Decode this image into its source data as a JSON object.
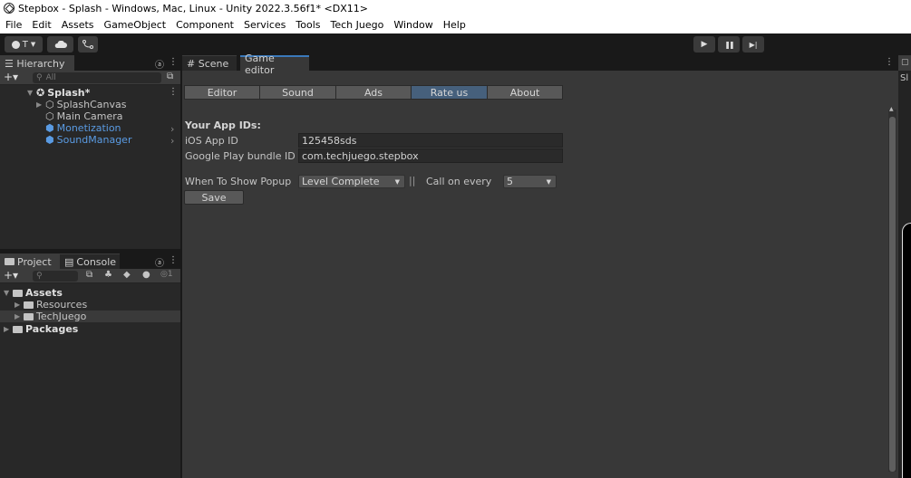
{
  "window": {
    "title": "Stepbox - Splash - Windows, Mac, Linux - Unity 2022.3.56f1* <DX11>"
  },
  "menu": [
    "File",
    "Edit",
    "Assets",
    "GameObject",
    "Component",
    "Services",
    "Tools",
    "Tech Juego",
    "Window",
    "Help"
  ],
  "toolbar": {
    "account_label": "T",
    "play_icon": "▶",
    "pause_icon": "❚❚",
    "step_icon": "▶|"
  },
  "hierarchy": {
    "tab_label": "☰ Hierarchy",
    "search_placeholder": "All",
    "scene": "Splash*",
    "items": [
      "SplashCanvas",
      "Main Camera",
      "Monetization",
      "SoundManager"
    ]
  },
  "project": {
    "tabs": [
      "Project",
      "Console"
    ],
    "search_placeholder": "",
    "count_hint": "1",
    "items": [
      "Assets",
      "Resources",
      "TechJuego",
      "Packages"
    ]
  },
  "editor": {
    "tabs": [
      "# Scene",
      "Game editor"
    ],
    "segments": [
      "Editor",
      "Sound",
      "Ads",
      "Rate us",
      "About"
    ],
    "active_segment": "Rate us",
    "section_title": "Your App IDs:",
    "ios_label": "iOS App ID",
    "ios_value": "125458sds",
    "android_label": "Google Play bundle ID",
    "android_value": "com.techjuego.stepbox",
    "popup_label": "When To Show Popup",
    "popup_value": "Level Complete",
    "separator": "||",
    "call_label": "Call on every",
    "call_value": "5",
    "save_label": "Save"
  },
  "right_panel": {
    "label": "Sl"
  }
}
